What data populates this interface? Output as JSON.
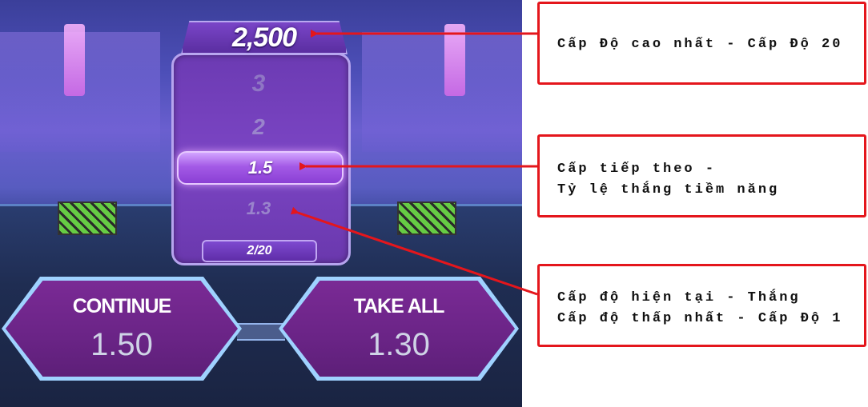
{
  "game": {
    "top_multiplier": "2,500",
    "levels": {
      "level_3": "3",
      "level_2": "2",
      "next": "1.5",
      "current": "1.3"
    },
    "counter": "2/20",
    "buttons": {
      "continue": {
        "label": "CONTINUE",
        "value": "1.50"
      },
      "take_all": {
        "label": "TAKE ALL",
        "value": "1.30"
      }
    }
  },
  "callouts": {
    "top": {
      "line1": "Cấp Độ cao nhất - Cấp Độ 20"
    },
    "next": {
      "line1": "Cấp tiếp theo -",
      "line2": "Tỷ lệ thắng tiềm năng"
    },
    "current": {
      "line1": "Cấp độ hiện tại - Thắng",
      "line2": "Cấp độ thấp nhất - Cấp Độ 1"
    }
  },
  "colors": {
    "callout_border": "#e4161c",
    "arrow": "#e4161c",
    "column_purple": "#7b45c4"
  },
  "icons": [
    "arrow-to-top-score",
    "arrow-to-next-level",
    "arrow-to-current-level"
  ]
}
